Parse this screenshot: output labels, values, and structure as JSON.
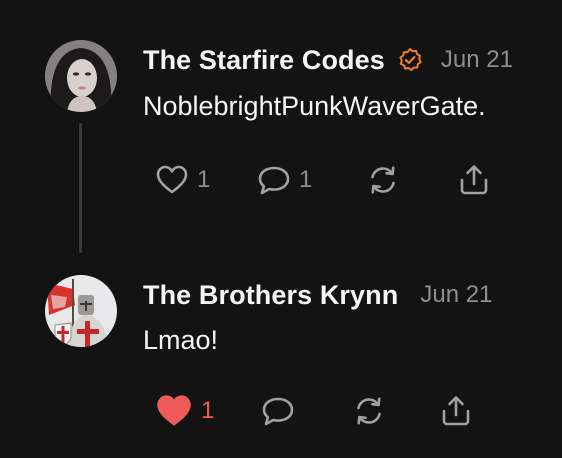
{
  "posts": [
    {
      "author": "The Starfire Codes",
      "verified": true,
      "date": "Jun 21",
      "text": "NoblebrightPunkWaverGate.",
      "avatar_icon": "user-avatar-photo",
      "actions": {
        "like_icon": "heart-outline-icon",
        "like_count": "1",
        "liked": false,
        "reply_icon": "comment-icon",
        "reply_count": "1",
        "repost_icon": "repost-icon",
        "share_icon": "share-icon"
      }
    },
    {
      "author": "The Brothers Krynn",
      "verified": false,
      "date": "Jun 21",
      "text": "Lmao!",
      "avatar_icon": "knight-avatar-image",
      "actions": {
        "like_icon": "heart-filled-icon",
        "like_count": "1",
        "liked": true,
        "reply_icon": "comment-icon",
        "reply_count": "",
        "repost_icon": "repost-icon",
        "share_icon": "share-icon"
      }
    }
  ],
  "colors": {
    "background": "#131314",
    "text_primary": "#f5f5f5",
    "text_secondary": "#8e8e93",
    "icon": "#a1a1a6",
    "verified_badge": "#f07d2c",
    "liked_heart": "#f05a5a",
    "thread_line": "#3a3a3c"
  }
}
